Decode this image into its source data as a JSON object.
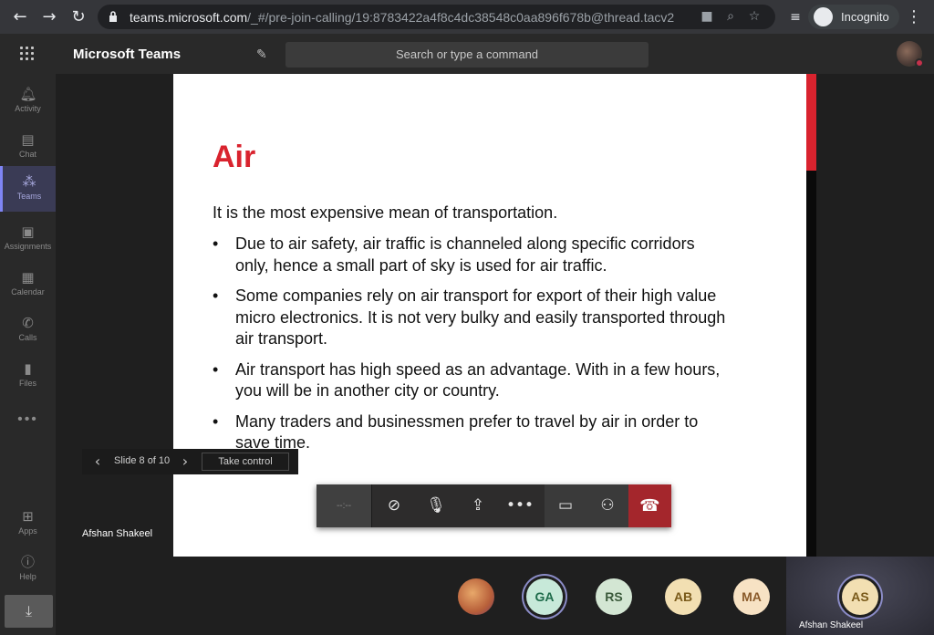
{
  "browser": {
    "url_host": "teams.microsoft.com",
    "url_path": "/_#/pre-join-calling/19:8783422a4f8c4dc38548c0aa896f678b@thread.tacv2",
    "incognito_label": "Incognito",
    "icons": [
      "back-icon",
      "forward-icon",
      "reload-icon",
      "lock-icon",
      "camera-icon",
      "zoom-icon",
      "star-icon",
      "media-icon",
      "incognito-icon",
      "menu-icon"
    ]
  },
  "teams": {
    "app_title": "Microsoft Teams",
    "search_placeholder": "Search or type a command"
  },
  "rail": {
    "items": [
      {
        "label": "Activity",
        "icon": "bell-icon"
      },
      {
        "label": "Chat",
        "icon": "chat-icon"
      },
      {
        "label": "Teams",
        "icon": "teams-icon",
        "active": true
      },
      {
        "label": "Assignments",
        "icon": "assignments-icon"
      },
      {
        "label": "Calendar",
        "icon": "calendar-icon"
      },
      {
        "label": "Calls",
        "icon": "phone-icon"
      },
      {
        "label": "Files",
        "icon": "file-icon"
      }
    ],
    "more": "•••",
    "apps_label": "Apps",
    "help_label": "Help"
  },
  "slide": {
    "title": "Air",
    "intro": "It is the most expensive mean of transportation.",
    "bullets": [
      "Due to air safety, air traffic is channeled along specific corridors only, hence a small part of sky is used for air traffic.",
      "Some companies rely on air transport for export of their high value micro electronics. It is not very bulky and easily transported through air transport.",
      "Air transport has high speed as an advantage. With in a few hours, you will be in another city or country.",
      "Many traders and businessmen prefer to travel by air in order to save time."
    ]
  },
  "slide_nav": {
    "counter": "Slide 8 of 10",
    "take_control": "Take control",
    "presenter": "Afshan Shakeel"
  },
  "call": {
    "timer": "--:--",
    "hangup_color": "#a4262c"
  },
  "participants": [
    {
      "initials": "",
      "bg": "#c9843a"
    },
    {
      "initials": "GA",
      "bg": "#c7e9d9",
      "fg": "#1e6b4a"
    },
    {
      "initials": "RS",
      "bg": "#d3e6d3",
      "fg": "#3b5a3b"
    },
    {
      "initials": "AB",
      "bg": "#f2dfb2",
      "fg": "#7a5a1a"
    },
    {
      "initials": "MA",
      "bg": "#f7e2c4",
      "fg": "#8a5a2a"
    }
  ],
  "self": {
    "initials": "AS",
    "name": "Afshan Shakeel",
    "bg": "#f2dfb2",
    "fg": "#7a5a1a"
  }
}
